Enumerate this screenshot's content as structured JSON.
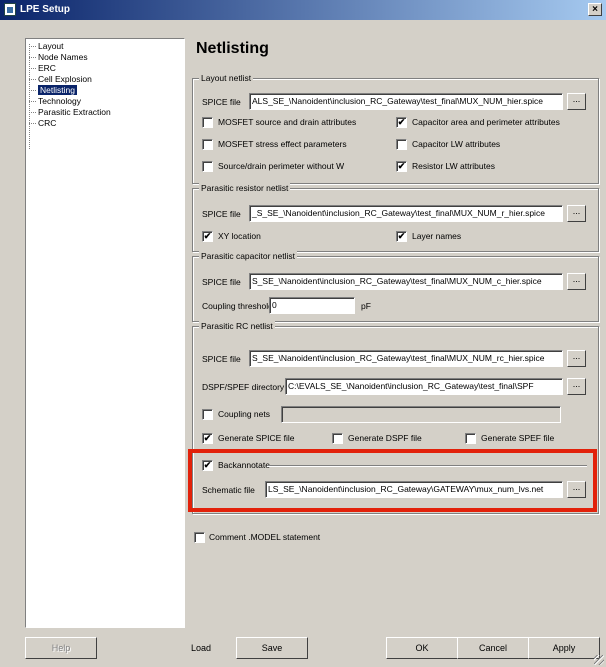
{
  "window": {
    "title": "LPE Setup",
    "close_glyph": "×"
  },
  "tree": {
    "items": [
      "Layout",
      "Node Names",
      "ERC",
      "Cell Explosion",
      "Netlisting",
      "Technology",
      "Parasitic Extraction",
      "CRC"
    ],
    "selected": "Netlisting"
  },
  "heading": "Netlisting",
  "layout_netlist": {
    "legend": "Layout netlist",
    "spice_label": "SPICE file",
    "spice_value": "ALS_SE_\\Nanoident\\inclusion_RC_Gateway\\test_final\\MUX_NUM_hier.spice",
    "mosfet_sd": {
      "label": "MOSFET source and drain attributes",
      "checked": false
    },
    "cap_area": {
      "label": "Capacitor area and perimeter attributes",
      "checked": true
    },
    "mosfet_stress": {
      "label": "MOSFET stress effect parameters",
      "checked": false
    },
    "cap_lw": {
      "label": "Capacitor LW attributes",
      "checked": false
    },
    "sd_perimeter": {
      "label": "Source/drain perimeter without W",
      "checked": false
    },
    "res_lw": {
      "label": "Resistor LW attributes",
      "checked": true
    }
  },
  "resistor_netlist": {
    "legend": "Parasitic resistor netlist",
    "spice_label": "SPICE file",
    "spice_value": "_S_SE_\\Nanoident\\inclusion_RC_Gateway\\test_final\\MUX_NUM_r_hier.spice",
    "xy": {
      "label": "XY location",
      "checked": true
    },
    "layer_names": {
      "label": "Layer names",
      "checked": true
    }
  },
  "capacitor_netlist": {
    "legend": "Parasitic capacitor netlist",
    "spice_label": "SPICE file",
    "spice_value": "S_SE_\\Nanoident\\inclusion_RC_Gateway\\test_final\\MUX_NUM_c_hier.spice",
    "threshold_label": "Coupling threshold",
    "threshold_value": "0",
    "threshold_unit": "pF"
  },
  "rc_netlist": {
    "legend": "Parasitic RC netlist",
    "spice_label": "SPICE file",
    "spice_value": "S_SE_\\Nanoident\\inclusion_RC_Gateway\\test_final\\MUX_NUM_rc_hier.spice",
    "dspf_label": "DSPF/SPEF directory",
    "dspf_value": "C:\\EVALS_SE_\\Nanoident\\inclusion_RC_Gateway\\test_final\\SPF",
    "coupling_nets": {
      "label": "Coupling nets",
      "checked": false,
      "value": ""
    },
    "gen_spice": {
      "label": "Generate SPICE file",
      "checked": true
    },
    "gen_dspf": {
      "label": "Generate DSPF file",
      "checked": false
    },
    "gen_spef": {
      "label": "Generate SPEF file",
      "checked": false
    }
  },
  "backannotate": {
    "label": "Backannotate",
    "checked": true,
    "schematic_label": "Schematic file",
    "schematic_value": "LS_SE_\\Nanoident\\inclusion_RC_Gateway\\GATEWAY\\mux_num_lvs.net"
  },
  "comment": {
    "label": "Comment .MODEL statement",
    "checked": false
  },
  "buttons": {
    "help": "Help",
    "load": "Load",
    "save": "Save",
    "ok": "OK",
    "cancel": "Cancel",
    "apply": "Apply"
  },
  "browse_glyph": "...",
  "check_glyph": "✔",
  "colors": {
    "highlight": "#e2210a",
    "titlebar": "#0a246a",
    "selection": "#0a246a"
  }
}
